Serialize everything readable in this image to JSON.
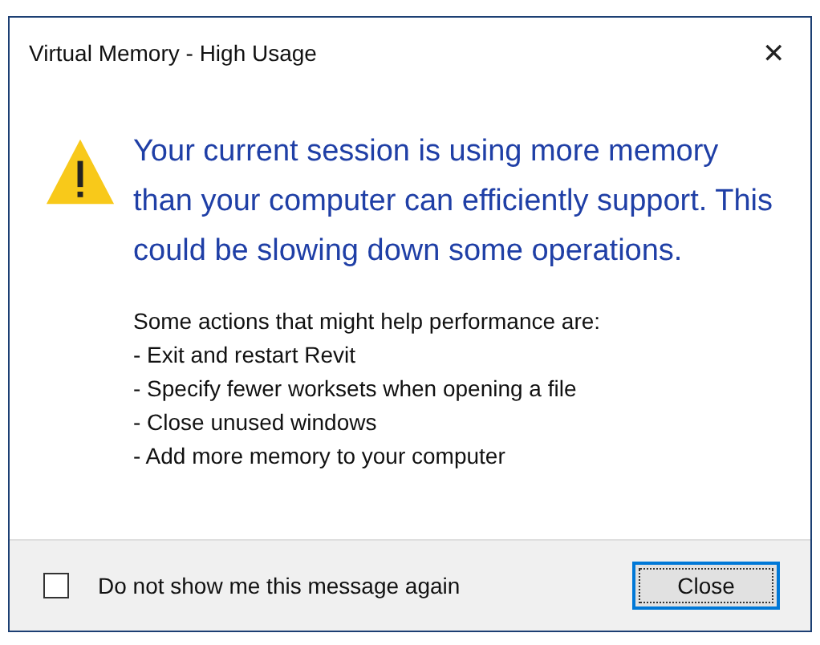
{
  "window": {
    "title": "Virtual Memory - High Usage",
    "close_glyph": "✕"
  },
  "message": {
    "heading": "Your current session is using more memory than your computer can efficiently support.  This could be slowing down some operations.",
    "intro": "Some actions that might help performance are:",
    "items": [
      "- Exit and restart Revit",
      "- Specify fewer worksets when opening a file",
      "- Close unused windows",
      "- Add more memory to your computer"
    ]
  },
  "footer": {
    "checkbox": {
      "label": "Do not show me this message again",
      "checked": false
    },
    "button": {
      "label": "Close",
      "focused": true
    }
  }
}
